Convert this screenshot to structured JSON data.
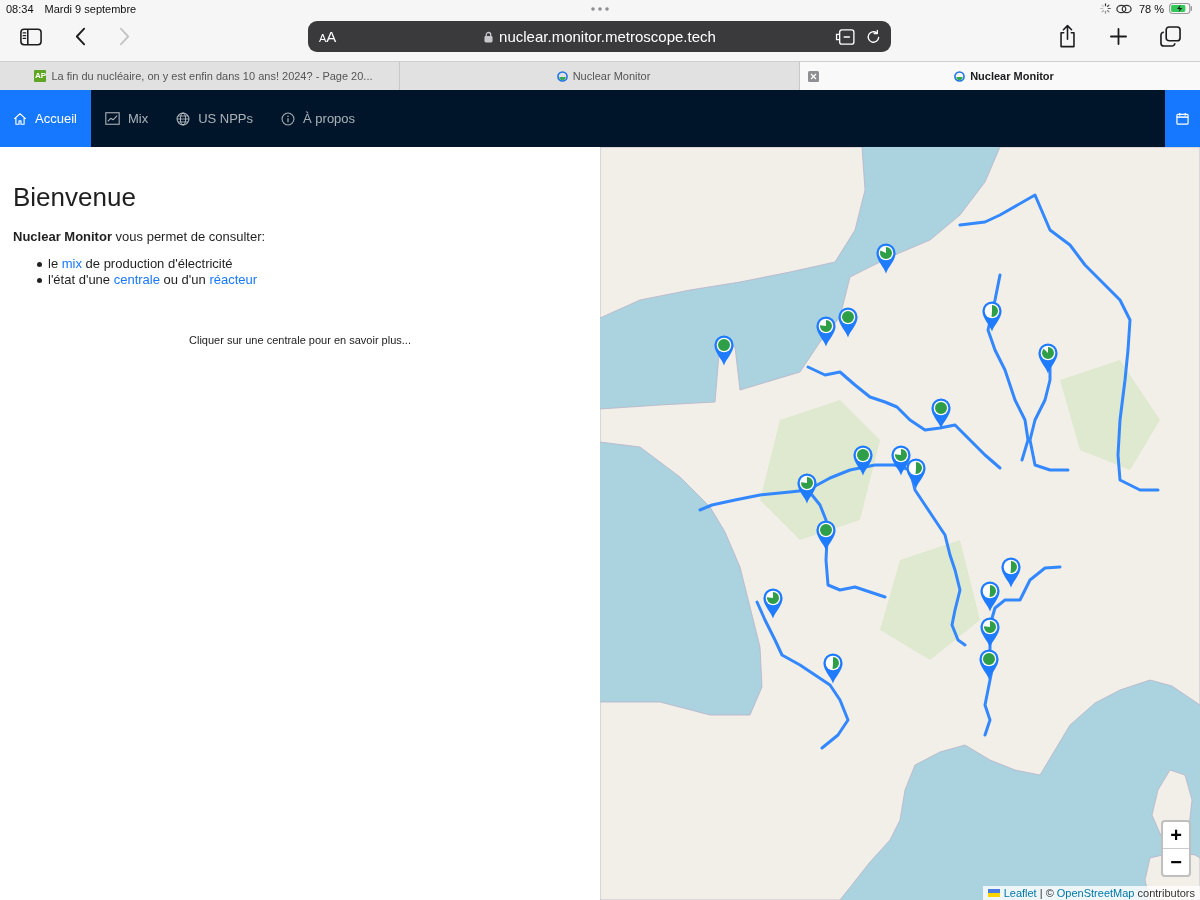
{
  "status_bar": {
    "time": "08:34",
    "date": "Mardi 9 septembre",
    "battery": "78 %"
  },
  "browser": {
    "back_disabled": false,
    "forward_disabled": true,
    "format_button": "AA",
    "url": "nuclear.monitor.metroscope.tech"
  },
  "tabs": [
    {
      "favicon_text": "AP",
      "title": "La fin du nucléaire, on y est enfin dans 10 ans! 2024? - Page 20...",
      "selected": false
    },
    {
      "title": "Nuclear Monitor",
      "selected": false
    },
    {
      "title": "Nuclear Monitor",
      "selected": true
    }
  ],
  "nav": {
    "items": [
      {
        "label": "Accueil",
        "selected": true
      },
      {
        "label": "Mix",
        "selected": false
      },
      {
        "label": "US NPPs",
        "selected": false
      },
      {
        "label": "À propos",
        "selected": false
      }
    ]
  },
  "welcome": {
    "title": "Bienvenue",
    "intro": "**Nuclear Monitor** vous permet de consulter:",
    "bullets": [
      {
        "parts": [
          {
            "kind": "text",
            "text": "le "
          },
          {
            "kind": "link",
            "text": "mix"
          },
          {
            "kind": "text",
            "text": " de production d'électricité"
          }
        ]
      },
      {
        "parts": [
          {
            "kind": "text",
            "text": "l'état d'une "
          },
          {
            "kind": "link",
            "text": "centrale"
          },
          {
            "kind": "text",
            "text": " ou d'un "
          },
          {
            "kind": "link",
            "text": "réacteur"
          }
        ]
      }
    ],
    "hint": "Cliquer sur une centrale pour en savoir plus..."
  },
  "map": {
    "markers": [
      {
        "level": 0.8
      },
      {
        "level": 0.75
      },
      {
        "level": 1
      },
      {
        "level": 1
      },
      {
        "level": 0.5
      },
      {
        "level": 0.85
      },
      {
        "level": 1
      },
      {
        "level": 1
      },
      {
        "level": 0.75
      },
      {
        "level": 0.5
      },
      {
        "level": 0.75
      },
      {
        "level": 1
      },
      {
        "level": 0.75
      },
      {
        "level": 0.5
      },
      {
        "level": 0.5
      },
      {
        "level": 0.5
      },
      {
        "level": 0.75
      },
      {
        "level": 1
      }
    ],
    "zoom_in": "+",
    "zoom_out": "−",
    "attribution": [
      {
        "kind": "link",
        "text": "Leaflet"
      },
      {
        "kind": "text",
        "text": " | © "
      },
      {
        "kind": "link",
        "text": "OpenStreetMap"
      },
      {
        "kind": "text",
        "text": " contributors"
      }
    ]
  }
}
